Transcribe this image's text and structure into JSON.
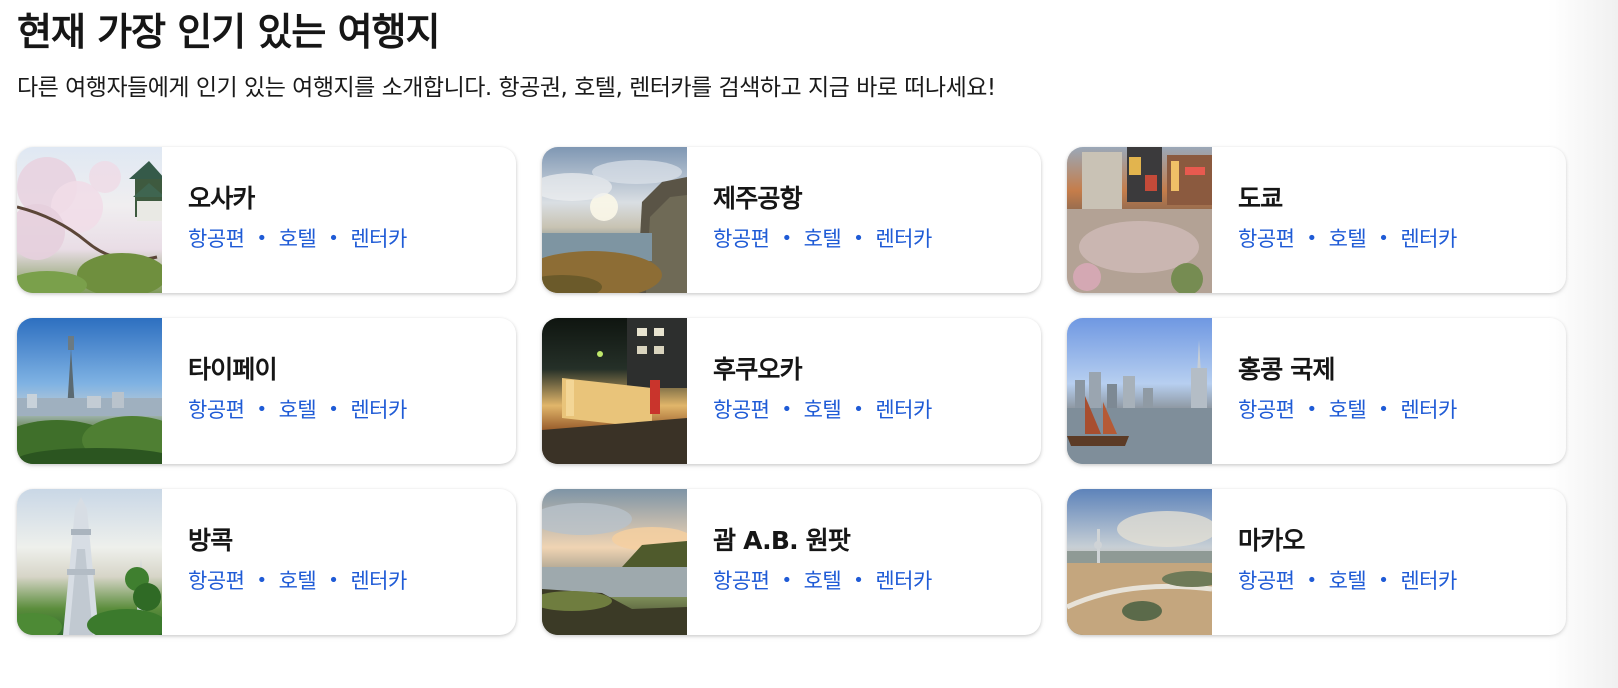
{
  "header": {
    "title": "현재 가장 인기 있는 여행지",
    "subtitle": "다른 여행자들에게 인기 있는 여행지를 소개합니다. 항공권, 호텔, 렌터카를 검색하고 지금 바로 떠나세요!"
  },
  "destinations": [
    {
      "name": "오사카",
      "links": [
        "항공편",
        "호텔",
        "렌터카"
      ],
      "image": "osaka-castle-cherry-blossom-photo"
    },
    {
      "name": "제주공항",
      "links": [
        "항공편",
        "호텔",
        "렌터카"
      ],
      "image": "jeju-coastal-cliff-photo"
    },
    {
      "name": "도쿄",
      "links": [
        "항공편",
        "호텔",
        "렌터카"
      ],
      "image": "tokyo-shibuya-crossing-photo"
    },
    {
      "name": "타이페이",
      "links": [
        "항공편",
        "호텔",
        "렌터카"
      ],
      "image": "taipei-101-skyline-photo"
    },
    {
      "name": "후쿠오카",
      "links": [
        "항공편",
        "호텔",
        "렌터카"
      ],
      "image": "fukuoka-night-food-stalls-photo"
    },
    {
      "name": "홍콩 국제",
      "links": [
        "항공편",
        "호텔",
        "렌터카"
      ],
      "image": "hong-kong-harbour-junk-boat-photo"
    },
    {
      "name": "방콕",
      "links": [
        "항공편",
        "호텔",
        "렌터카"
      ],
      "image": "bangkok-wat-arun-temple-photo"
    },
    {
      "name": "괌 A.B. 원팟",
      "links": [
        "항공편",
        "호텔",
        "렌터카"
      ],
      "image": "guam-rocky-shoreline-sunset-photo"
    },
    {
      "name": "마카오",
      "links": [
        "항공편",
        "호텔",
        "렌터카"
      ],
      "image": "macau-bridge-tower-aerial-photo"
    }
  ],
  "colors": {
    "link": "#1f5bd6",
    "text": "#161616",
    "card_bg": "#ffffff"
  }
}
